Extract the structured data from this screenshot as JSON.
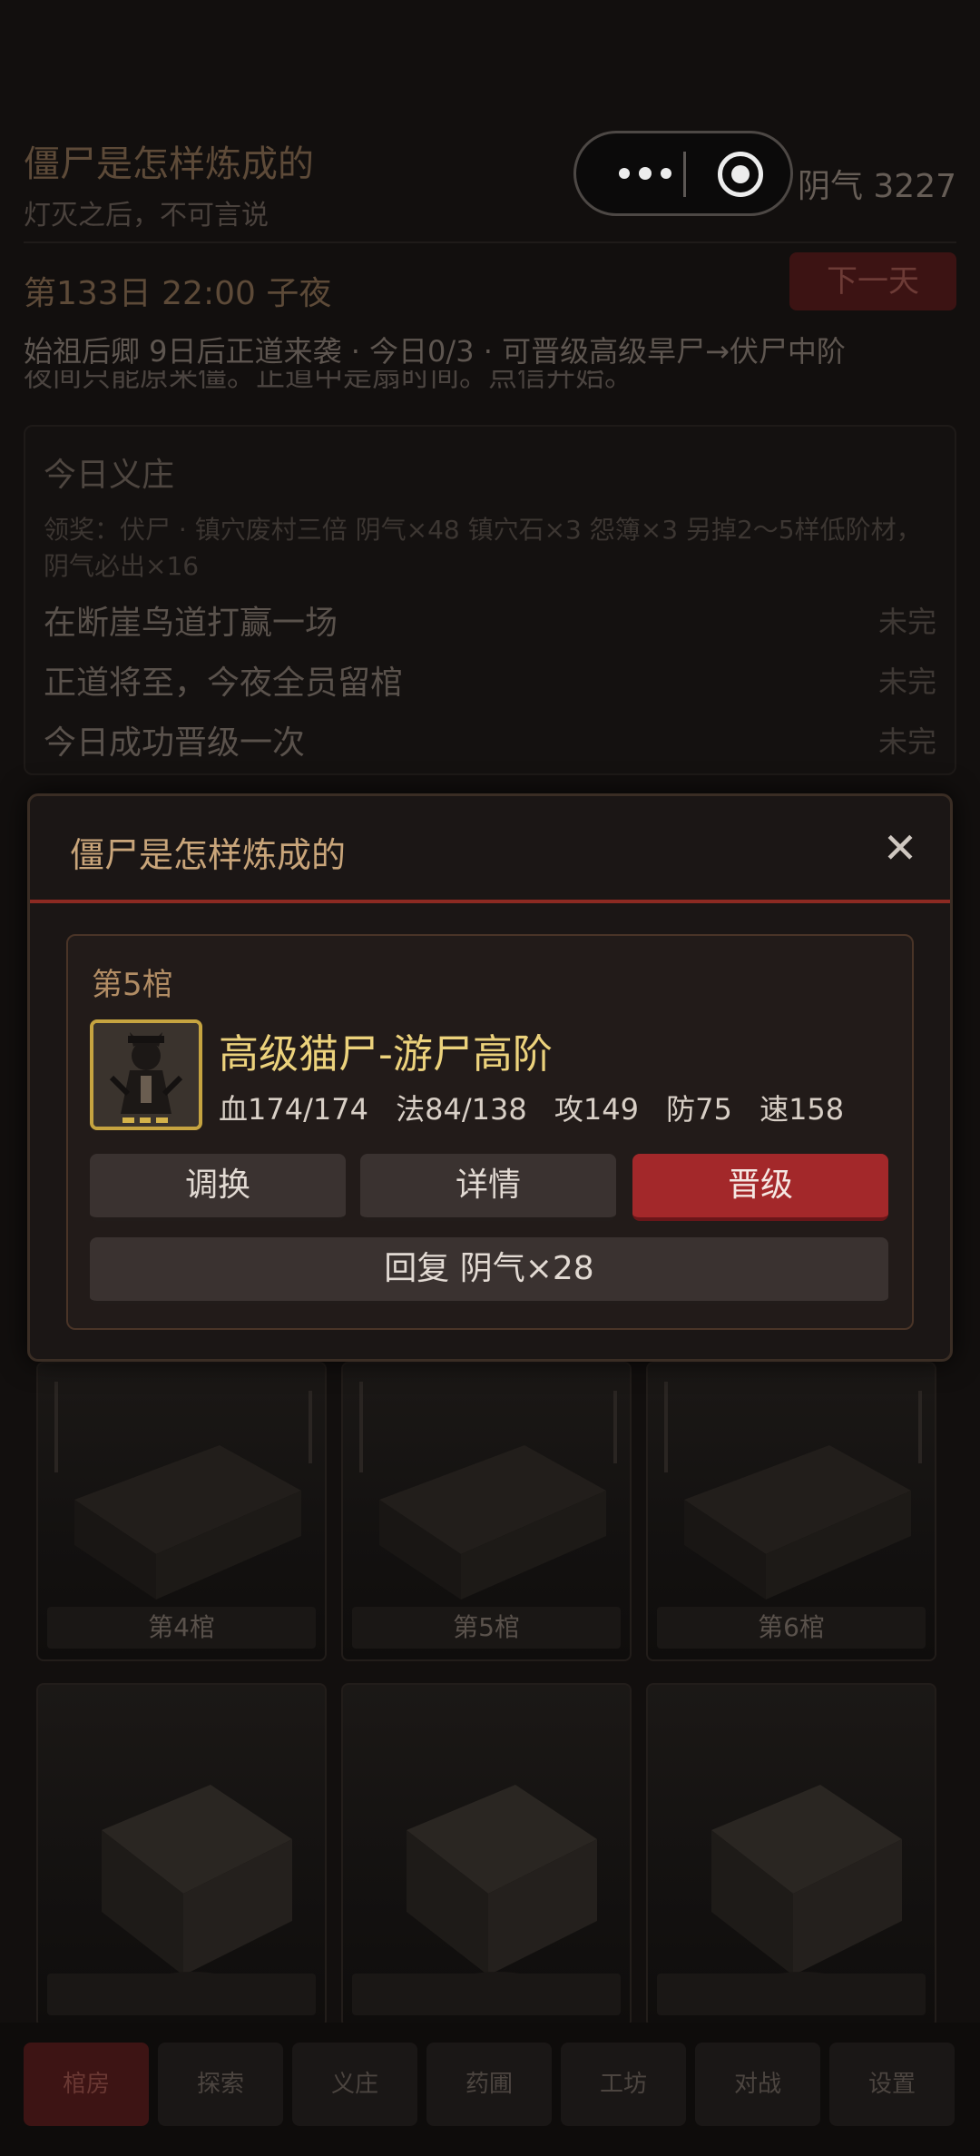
{
  "app": {
    "title": "僵尸是怎样炼成的",
    "subtitle": "灯灭之后，不可言说",
    "currency_label": "阴气 3227"
  },
  "status": {
    "day_time": "第133日  22:00  子夜",
    "next_day_label": "下一天",
    "info_line": "始祖后卿  9日后正道来袭 · 今日0/3 · 可晋级高级旱尸→伏尸中阶",
    "info_cut_line": "夜间只能原来僵。正道中是扇时间。点信开始。"
  },
  "tasks": {
    "title": "今日义庄",
    "reward": "领奖：伏尸 · 镇穴废村三倍  阴气×48  镇穴石×3  怨簿×3  另掉2～5样低阶材，阴气必出×16",
    "items": [
      {
        "label": "在断崖鸟道打赢一场",
        "status": "未完"
      },
      {
        "label": "正道将至，今夜全员留棺",
        "status": "未完"
      },
      {
        "label": "今日成功晋级一次",
        "status": "未完"
      }
    ]
  },
  "coffins": [
    {
      "label": "第4棺"
    },
    {
      "label": "第5棺"
    },
    {
      "label": "第6棺"
    },
    {
      "label": ""
    },
    {
      "label": ""
    },
    {
      "label": ""
    }
  ],
  "tabs": [
    "棺房",
    "探索",
    "义庄",
    "药圃",
    "工坊",
    "对战",
    "设置"
  ],
  "modal": {
    "title": "僵尸是怎样炼成的",
    "close_glyph": "✕",
    "slot_label": "第5棺",
    "unit_name": "高级猫尸-游尸高阶",
    "stats": {
      "hp": "血174/174",
      "mp": "法84/138",
      "atk": "攻149",
      "def": "防75",
      "spd": "速158"
    },
    "buttons": {
      "swap": "调换",
      "detail": "详情",
      "upgrade": "晋级",
      "restore": "回复 阴气×28"
    }
  },
  "colors": {
    "accent_red": "#a3282a",
    "gold": "#ecd27c",
    "modal_border": "#3a2d24"
  }
}
